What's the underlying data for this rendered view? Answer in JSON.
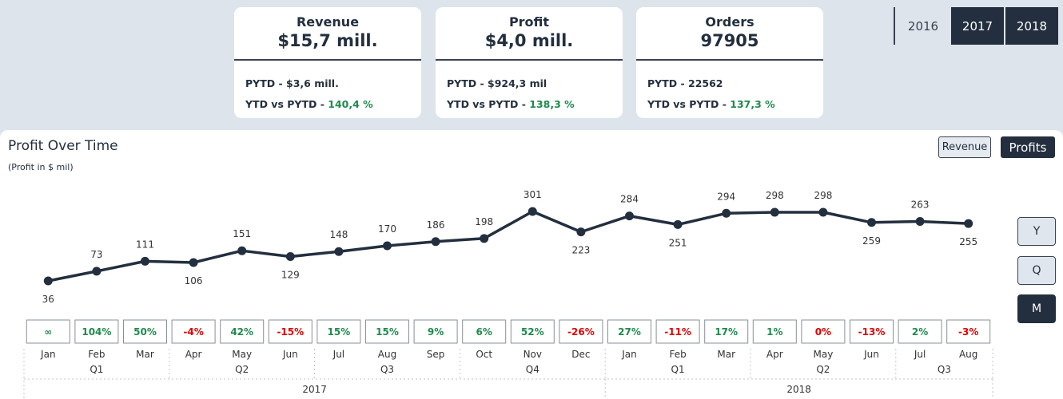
{
  "kpis": {
    "revenue": {
      "label": "Revenue",
      "value": "$15,7 mill.",
      "pytd": "PYTD - $3,6 mill.",
      "ytd_label": "YTD vs PYTD - ",
      "ytd_pct": "140,4 %"
    },
    "profit": {
      "label": "Profit",
      "value": "$4,0 mill.",
      "pytd": "PYTD - $924,3 mil",
      "ytd_label": "YTD vs PYTD - ",
      "ytd_pct": "138,3 %"
    },
    "orders": {
      "label": "Orders",
      "value": "97905",
      "pytd": "PYTD - 22562",
      "ytd_label": "YTD vs PYTD - ",
      "ytd_pct": "137,3 %"
    }
  },
  "year_slicer": [
    "2016",
    "2017",
    "2018"
  ],
  "year_selected": [
    "2017",
    "2018"
  ],
  "toggle": {
    "revenue": "Revenue",
    "profits": "Profits",
    "active": "Profits"
  },
  "granularity": {
    "y": "Y",
    "q": "Q",
    "m": "M",
    "active": "M"
  },
  "colors": {
    "line": "#232f3e",
    "positive": "#1e8a4c",
    "negative": "#e00000",
    "neutral": "#1e8a4c"
  },
  "chart_data": {
    "type": "line",
    "title": "Profit Over Time",
    "subtitle": "(Profit in $ mil)",
    "x": [
      "Jan",
      "Feb",
      "Mar",
      "Apr",
      "May",
      "Jun",
      "Jul",
      "Aug",
      "Sep",
      "Oct",
      "Nov",
      "Dec",
      "Jan",
      "Feb",
      "Mar",
      "Apr",
      "May",
      "Jun",
      "Jul",
      "Aug"
    ],
    "values": [
      36,
      73,
      111,
      106,
      151,
      129,
      148,
      170,
      186,
      198,
      301,
      223,
      284,
      251,
      294,
      298,
      298,
      259,
      263,
      255
    ],
    "growth": [
      "∞",
      "104%",
      "50%",
      "-4%",
      "42%",
      "-15%",
      "15%",
      "15%",
      "9%",
      "6%",
      "52%",
      "-26%",
      "27%",
      "-11%",
      "17%",
      "1%",
      "0%",
      "-13%",
      "2%",
      "-3%"
    ],
    "growth_sign": [
      1,
      1,
      1,
      -1,
      1,
      -1,
      1,
      1,
      1,
      1,
      1,
      -1,
      1,
      -1,
      1,
      1,
      -1,
      -1,
      1,
      -1
    ],
    "label_position": [
      "below",
      "above",
      "above",
      "below",
      "above",
      "below",
      "above",
      "above",
      "above",
      "above",
      "above",
      "below",
      "above",
      "below",
      "above",
      "above",
      "above",
      "below",
      "above",
      "below"
    ],
    "quarters": [
      {
        "label": "Q1",
        "span": 3
      },
      {
        "label": "Q2",
        "span": 3
      },
      {
        "label": "Q3",
        "span": 3
      },
      {
        "label": "Q4",
        "span": 3
      },
      {
        "label": "Q1",
        "span": 3
      },
      {
        "label": "Q2",
        "span": 3
      },
      {
        "label": "Q3",
        "span": 2
      }
    ],
    "years": [
      {
        "label": "2017",
        "span": 12
      },
      {
        "label": "2018",
        "span": 8
      }
    ],
    "grid": false,
    "legend": "none"
  }
}
